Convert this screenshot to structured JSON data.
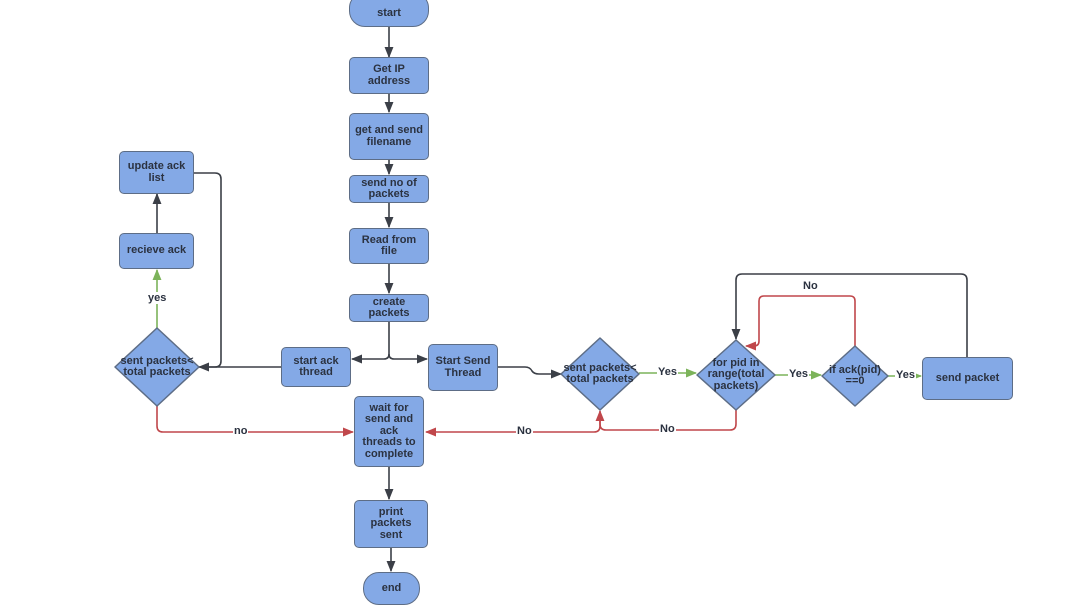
{
  "diagram": {
    "type": "flowchart",
    "colors": {
      "node_fill": "#84a9e6",
      "node_border": "#5d6d86",
      "text": "#2b3240",
      "edge_default": "#3b3f47",
      "edge_yes": "#7cb35a",
      "edge_no": "#c0474b"
    },
    "nodes": {
      "start": "start",
      "get_ip": "Get IP address",
      "get_filename": "get and send filename",
      "send_no_packets": "send no of packets",
      "read_file": "Read from file",
      "create_packets": "create packets",
      "start_ack_thread": "start ack thread",
      "start_send_thread": "Start Send Thread",
      "ack_decision": "sent packets< total packets",
      "recieve_ack": "recieve ack",
      "update_ack_list": "update ack list",
      "wait_threads": "wait for send and ack threads to complete",
      "print_packets": "print packets sent",
      "end": "end",
      "send_decision": "sent packets< total packets",
      "for_pid": "for pid in range(total packets)",
      "if_ack": "if ack(pid) ==0",
      "send_packet": "send packet"
    },
    "edge_labels": {
      "ack_yes": "yes",
      "ack_no": "no",
      "send_yes": "Yes",
      "send_no": "No",
      "for_yes": "Yes",
      "for_no": "No",
      "if_yes": "Yes",
      "if_no": "No"
    },
    "edges": [
      {
        "from": "start",
        "to": "get_ip",
        "kind": "default"
      },
      {
        "from": "get_ip",
        "to": "get_filename",
        "kind": "default"
      },
      {
        "from": "get_filename",
        "to": "send_no_packets",
        "kind": "default"
      },
      {
        "from": "send_no_packets",
        "to": "read_file",
        "kind": "default"
      },
      {
        "from": "read_file",
        "to": "create_packets",
        "kind": "default"
      },
      {
        "from": "create_packets",
        "to": "start_ack_thread",
        "kind": "default"
      },
      {
        "from": "create_packets",
        "to": "start_send_thread",
        "kind": "default"
      },
      {
        "from": "start_ack_thread",
        "to": "ack_decision",
        "kind": "default"
      },
      {
        "from": "ack_decision",
        "to": "recieve_ack",
        "kind": "yes",
        "label": "yes"
      },
      {
        "from": "recieve_ack",
        "to": "update_ack_list",
        "kind": "default"
      },
      {
        "from": "update_ack_list",
        "to": "ack_decision",
        "kind": "default"
      },
      {
        "from": "ack_decision",
        "to": "wait_threads",
        "kind": "no",
        "label": "no"
      },
      {
        "from": "start_send_thread",
        "to": "send_decision",
        "kind": "default"
      },
      {
        "from": "send_decision",
        "to": "for_pid",
        "kind": "yes",
        "label": "Yes"
      },
      {
        "from": "send_decision",
        "to": "wait_threads",
        "kind": "no",
        "label": "No"
      },
      {
        "from": "for_pid",
        "to": "if_ack",
        "kind": "yes",
        "label": "Yes"
      },
      {
        "from": "for_pid",
        "to": "send_decision",
        "kind": "no",
        "label": "No"
      },
      {
        "from": "if_ack",
        "to": "send_packet",
        "kind": "yes",
        "label": "Yes"
      },
      {
        "from": "if_ack",
        "to": "for_pid",
        "kind": "no",
        "label": "No"
      },
      {
        "from": "send_packet",
        "to": "for_pid",
        "kind": "default"
      },
      {
        "from": "wait_threads",
        "to": "print_packets",
        "kind": "default"
      },
      {
        "from": "print_packets",
        "to": "end",
        "kind": "default"
      }
    ]
  }
}
